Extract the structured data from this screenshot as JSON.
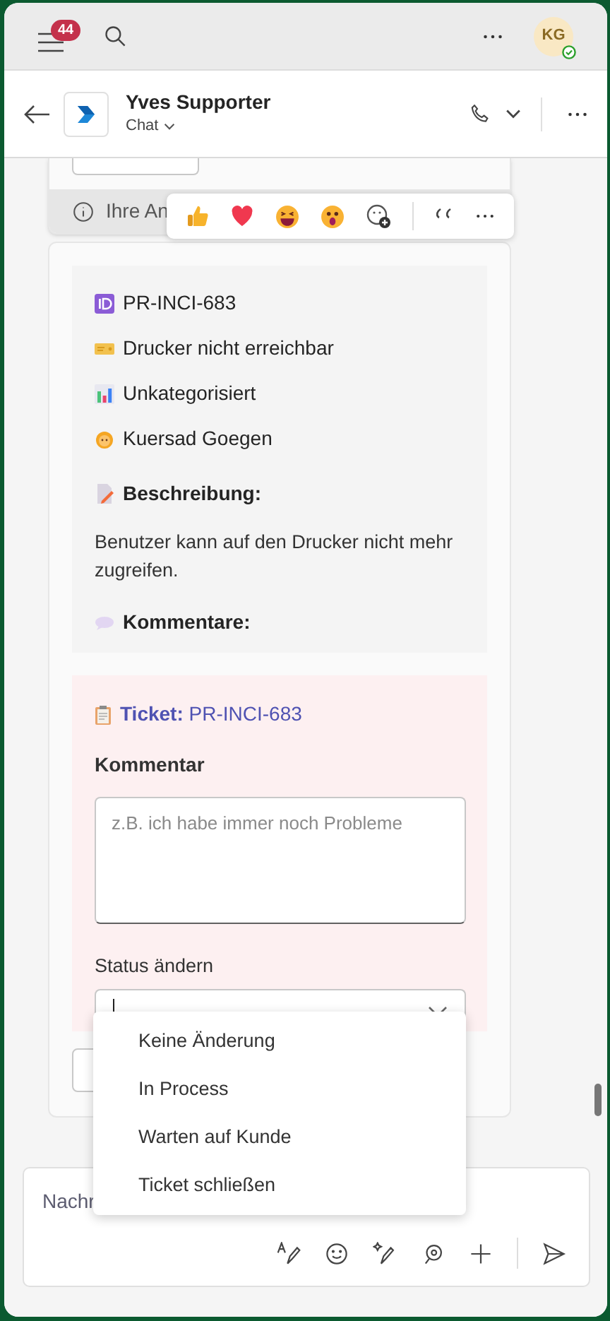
{
  "top_bar": {
    "badge": "44",
    "avatar": "KG"
  },
  "chat_header": {
    "name": "Yves Supporter",
    "subtitle": "Chat"
  },
  "previous_message": {
    "info": "Ihre An"
  },
  "ticket_card": {
    "details": [
      {
        "kind": "id",
        "text": "PR-INCI-683"
      },
      {
        "kind": "ticket",
        "text": "Drucker nicht erreichbar"
      },
      {
        "kind": "chart",
        "text": "Unkategorisiert"
      },
      {
        "kind": "person",
        "text": "Kuersad Goegen"
      }
    ],
    "description_label": "Beschreibung:",
    "description": "Benutzer kann auf den Drucker nicht mehr zugreifen.",
    "comments_label": "Kommentare:"
  },
  "form": {
    "title": "**Ticket:** PR-INCI-683",
    "comment_label": "Kommentar",
    "comment_placeholder": "z.B. ich habe immer noch Probleme",
    "status_label": "Status ändern",
    "status_options": [
      {
        "label": "Keine Änderung",
        "selected": false
      },
      {
        "label": "In Process",
        "selected": false
      },
      {
        "label": "Warten auf Kunde",
        "selected": false
      },
      {
        "label": "Ticket schließen",
        "selected": false
      }
    ]
  },
  "composer": {
    "placeholder": "Nachr"
  }
}
